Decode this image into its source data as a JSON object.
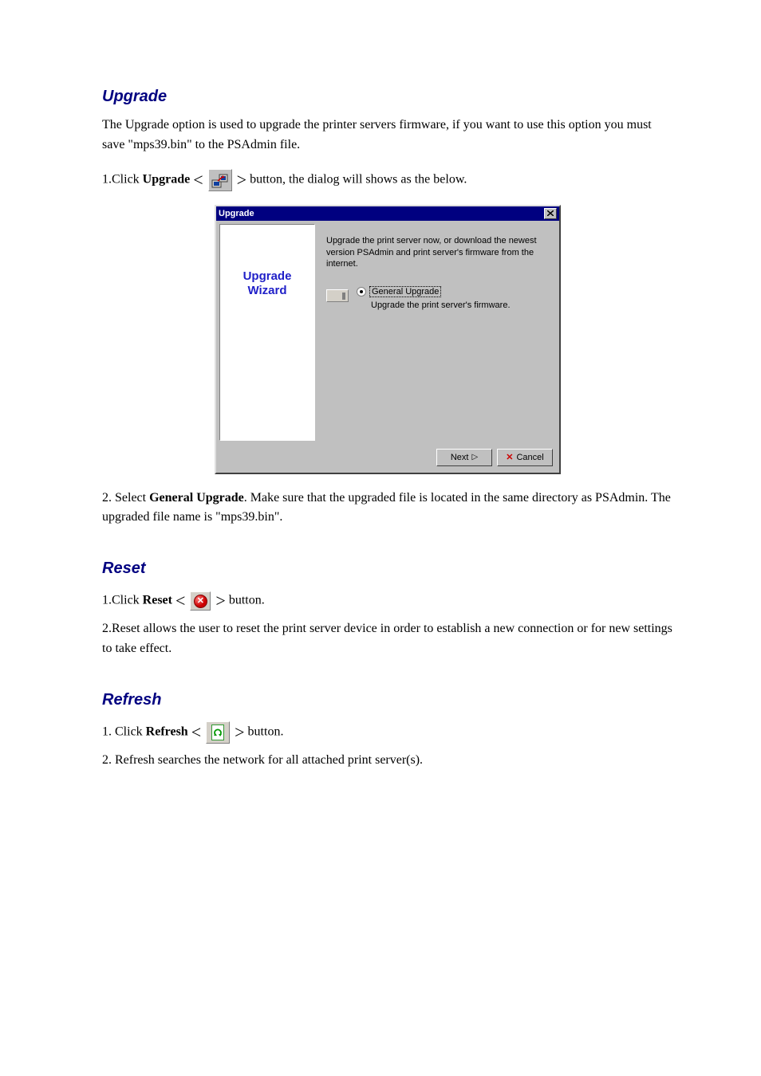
{
  "section_upgrade": {
    "title": "Upgrade",
    "intro": "The Upgrade option is used to upgrade the printer servers firmware, if you want to use this option you must save \"mps39.bin\" to the PSAdmin file.",
    "step1_prefix": "1.Click ",
    "step1_mid": "Upgrade",
    "step1_suffix": " button, the dialog will shows as the below.",
    "dialog": {
      "title": "Upgrade",
      "side_line1": "Upgrade",
      "side_line2": "Wizard",
      "desc": "Upgrade the print server now, or download the newest version PSAdmin and print server's firmware from the internet.",
      "radio_label": "General Upgrade",
      "option_desc": "Upgrade the print server's firmware.",
      "next_label": "Next",
      "cancel_label": "Cancel"
    },
    "step2_prefix": "2. Select ",
    "step2_bold": "General Upgrade",
    "step2_suffix": ". Make sure that the upgraded file is located in the same directory as PSAdmin. The upgraded file name is \"mps39.bin\"."
  },
  "section_reset": {
    "title": "Reset",
    "step1_prefix": "1.Click ",
    "step1_mid": "Reset",
    "step1_suffix": " button.",
    "step2": "2.Reset allows the user to reset the print server device in order to establish a new connection or for new settings to take effect."
  },
  "section_refresh": {
    "title": "Refresh",
    "step1_prefix": "1. Click ",
    "step1_mid": "Refresh",
    "step1_suffix": " button.",
    "step2": "2. Refresh searches the network for all attached print server(s)."
  }
}
